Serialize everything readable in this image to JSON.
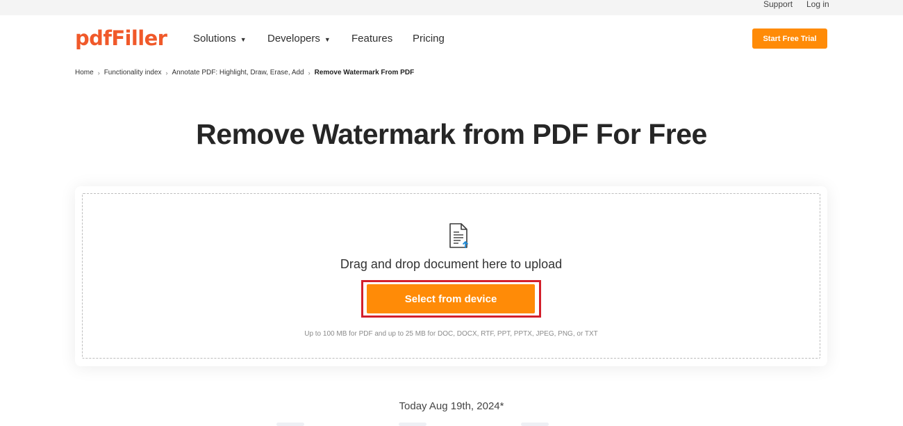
{
  "topbar": {
    "support": "Support",
    "login": "Log in"
  },
  "header": {
    "logo": "pdfFiller",
    "nav": [
      {
        "label": "Solutions",
        "dropdown": true
      },
      {
        "label": "Developers",
        "dropdown": true
      },
      {
        "label": "Features",
        "dropdown": false
      },
      {
        "label": "Pricing",
        "dropdown": false
      }
    ],
    "cta_label": "Start Free Trial"
  },
  "breadcrumb": {
    "items": [
      "Home",
      "Functionality index",
      "Annotate PDF: Highlight, Draw, Erase, Add",
      "Remove Watermark From PDF"
    ],
    "separator": "›"
  },
  "page_title": "Remove Watermark from PDF For Free",
  "upload": {
    "icon": "document-upload-icon",
    "prompt": "Drag and drop document here to upload",
    "button_label": "Select from device",
    "limits_text": "Up to 100 MB for PDF and up to 25 MB for DOC, DOCX, RTF, PPT, PPTX, JPEG, PNG, or TXT"
  },
  "date_text": "Today Aug 19th, 2024*",
  "colors": {
    "brand": "#f0592a",
    "accent": "#ff8b07",
    "highlight": "#d31f2b"
  }
}
